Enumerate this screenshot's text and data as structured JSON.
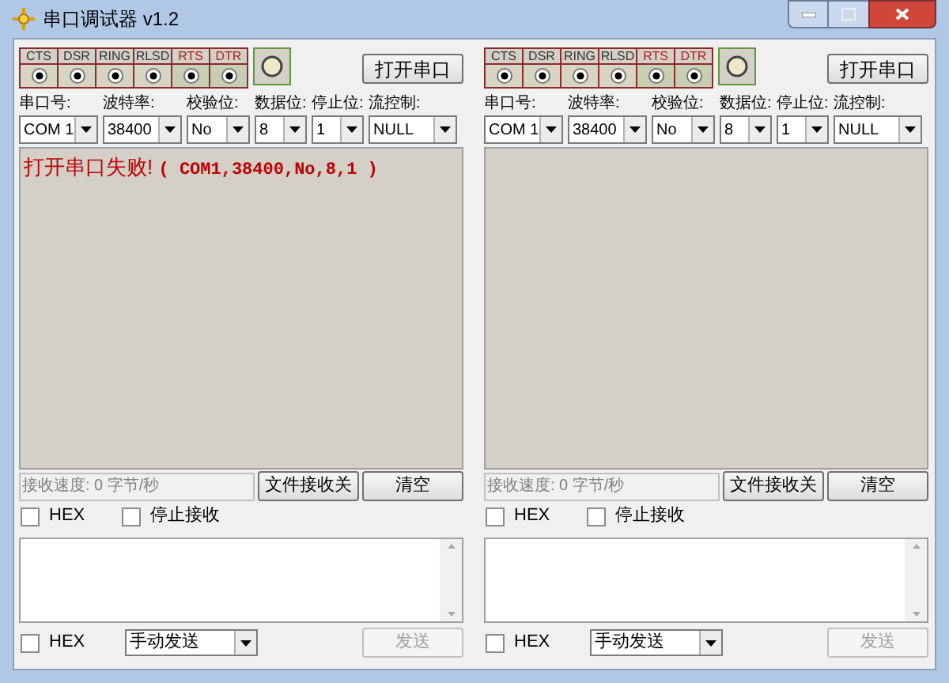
{
  "window": {
    "title": "串口调试器 v1.2"
  },
  "panels": [
    {
      "signals": [
        {
          "name": "CTS",
          "kind": "input"
        },
        {
          "name": "DSR",
          "kind": "input"
        },
        {
          "name": "RING",
          "kind": "input"
        },
        {
          "name": "RLSD",
          "kind": "input"
        },
        {
          "name": "RTS",
          "kind": "output"
        },
        {
          "name": "DTR",
          "kind": "output"
        }
      ],
      "open_button": "打开串口",
      "settings": [
        {
          "label": "串口号:",
          "value": "COM 1"
        },
        {
          "label": "波特率:",
          "value": "38400"
        },
        {
          "label": "校验位:",
          "value": "No"
        },
        {
          "label": "数据位:",
          "value": "8"
        },
        {
          "label": "停止位:",
          "value": "1"
        },
        {
          "label": "流控制:",
          "value": "NULL"
        }
      ],
      "receive_message": {
        "text": "打开串口失败!",
        "detail": "( COM1,38400,No,8,1 )"
      },
      "receive_speed": "接收速度: 0 字节/秒",
      "file_receive_button": "文件接收关",
      "clear_button": "清空",
      "receive_options": [
        {
          "label": "HEX",
          "checked": false
        },
        {
          "label": "停止接收",
          "checked": false
        }
      ],
      "send_hex": {
        "label": "HEX",
        "checked": false
      },
      "send_mode": "手动发送",
      "send_button": {
        "label": "发送",
        "disabled": true
      }
    },
    {
      "signals": [
        {
          "name": "CTS",
          "kind": "input"
        },
        {
          "name": "DSR",
          "kind": "input"
        },
        {
          "name": "RING",
          "kind": "input"
        },
        {
          "name": "RLSD",
          "kind": "input"
        },
        {
          "name": "RTS",
          "kind": "output"
        },
        {
          "name": "DTR",
          "kind": "output"
        }
      ],
      "open_button": "打开串口",
      "settings": [
        {
          "label": "串口号:",
          "value": "COM 1"
        },
        {
          "label": "波特率:",
          "value": "38400"
        },
        {
          "label": "校验位:",
          "value": "No"
        },
        {
          "label": "数据位:",
          "value": "8"
        },
        {
          "label": "停止位:",
          "value": "1"
        },
        {
          "label": "流控制:",
          "value": "NULL"
        }
      ],
      "receive_speed": "接收速度: 0 字节/秒",
      "file_receive_button": "文件接收关",
      "clear_button": "清空",
      "receive_options": [
        {
          "label": "HEX",
          "checked": false
        },
        {
          "label": "停止接收",
          "checked": false
        }
      ],
      "send_hex": {
        "label": "HEX",
        "checked": false
      },
      "send_mode": "手动发送",
      "send_button": {
        "label": "发送",
        "disabled": true
      }
    }
  ]
}
